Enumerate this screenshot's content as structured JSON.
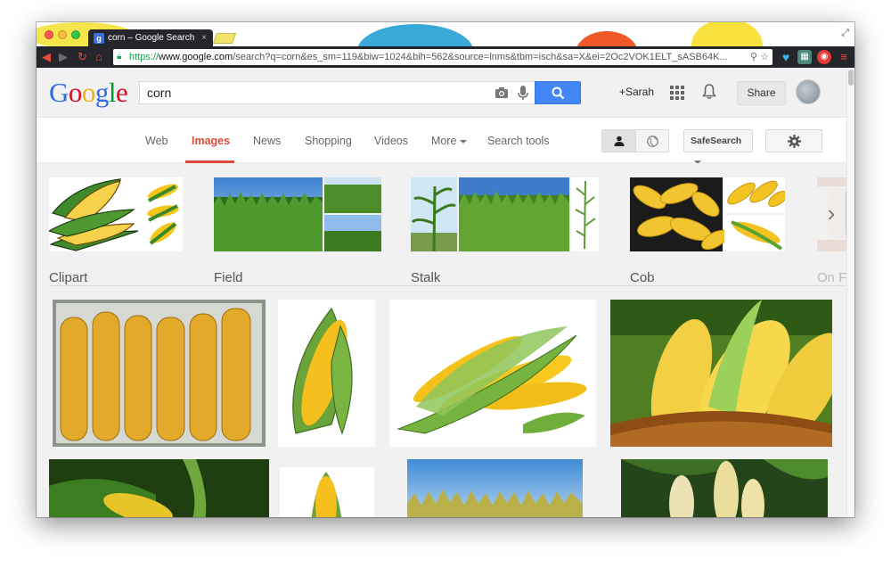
{
  "browser": {
    "tab_title": "corn – Google Search",
    "tab_close": "×",
    "url_scheme": "https://",
    "url_domain": "www.google.com",
    "url_path": "/search?q=corn&es_sm=119&biw=1024&bih=562&source=lnms&tbm=isch&sa=X&ei=2Oc2VOK1ELT_sASB64K..."
  },
  "google": {
    "logo_letters": [
      "G",
      "o",
      "o",
      "g",
      "l",
      "e"
    ],
    "search_value": "corn",
    "plus_user": "+Sarah",
    "share_label": "Share"
  },
  "nav": {
    "tabs": [
      {
        "label": "Web"
      },
      {
        "label": "Images",
        "active": true
      },
      {
        "label": "News"
      },
      {
        "label": "Shopping"
      },
      {
        "label": "Videos"
      },
      {
        "label": "More"
      },
      {
        "label": "Search tools"
      }
    ],
    "safesearch_label": "SafeSearch"
  },
  "related_searches": [
    {
      "label": "Clipart"
    },
    {
      "label": "Field"
    },
    {
      "label": "Stalk"
    },
    {
      "label": "Cob"
    },
    {
      "label": "On F"
    }
  ],
  "colors": {
    "accent_red": "#dd4b39",
    "search_blue": "#4285f4",
    "browser_dark": "#24262b"
  }
}
